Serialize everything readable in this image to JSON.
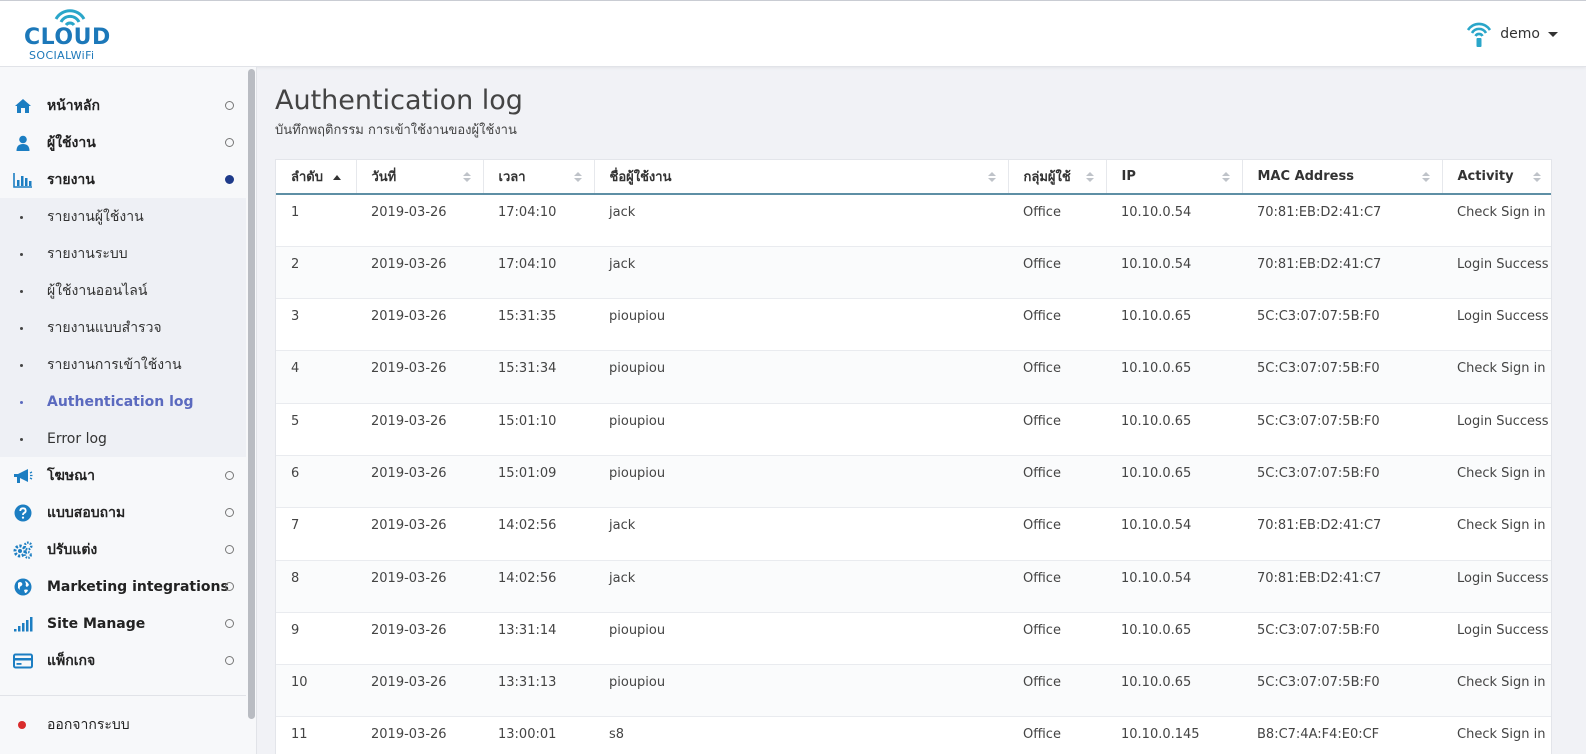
{
  "header": {
    "logo_main": "CLOUD",
    "logo_sub": "SOCIALWiFi",
    "user_name": "demo"
  },
  "sidebar": {
    "items": [
      {
        "label": "หน้าหลัก",
        "icon": "home-icon"
      },
      {
        "label": "ผู้ใช้งาน",
        "icon": "user-icon"
      },
      {
        "label": "รายงาน",
        "icon": "bar-chart-icon"
      },
      {
        "label": "โฆษณา",
        "icon": "megaphone-icon"
      },
      {
        "label": "แบบสอบถาม",
        "icon": "question-icon"
      },
      {
        "label": "ปรับแต่ง",
        "icon": "gears-icon"
      },
      {
        "label": "Marketing integrations",
        "icon": "globe-icon"
      },
      {
        "label": "Site Manage",
        "icon": "signal-icon"
      },
      {
        "label": "แพ็กเกจ",
        "icon": "credit-card-icon"
      }
    ],
    "report_submenu": [
      "รายงานผู้ใช้งาน",
      "รายงานระบบ",
      "ผู้ใช้งานออนไลน์",
      "รายงานแบบสำรวจ",
      "รายงานการเข้าใช้งาน",
      "Authentication log",
      "Error log"
    ],
    "logout": "ออกจากระบบ"
  },
  "page": {
    "title": "Authentication log",
    "subtitle": "บันทึกพฤติกรรม การเข้าใช้งานของผู้ใช้งาน"
  },
  "table": {
    "columns": [
      "ลำดับ",
      "วันที่",
      "เวลา",
      "ชื่อผู้ใช้งาน",
      "กลุ่มผู้ใช้",
      "IP",
      "MAC Address",
      "Activity"
    ],
    "rows": [
      [
        "1",
        "2019-03-26",
        "17:04:10",
        "jack",
        "Office",
        "10.10.0.54",
        "70:81:EB:D2:41:C7",
        "Check Sign in"
      ],
      [
        "2",
        "2019-03-26",
        "17:04:10",
        "jack",
        "Office",
        "10.10.0.54",
        "70:81:EB:D2:41:C7",
        "Login Success"
      ],
      [
        "3",
        "2019-03-26",
        "15:31:35",
        "pioupiou",
        "Office",
        "10.10.0.65",
        "5C:C3:07:07:5B:F0",
        "Login Success"
      ],
      [
        "4",
        "2019-03-26",
        "15:31:34",
        "pioupiou",
        "Office",
        "10.10.0.65",
        "5C:C3:07:07:5B:F0",
        "Check Sign in"
      ],
      [
        "5",
        "2019-03-26",
        "15:01:10",
        "pioupiou",
        "Office",
        "10.10.0.65",
        "5C:C3:07:07:5B:F0",
        "Login Success"
      ],
      [
        "6",
        "2019-03-26",
        "15:01:09",
        "pioupiou",
        "Office",
        "10.10.0.65",
        "5C:C3:07:07:5B:F0",
        "Check Sign in"
      ],
      [
        "7",
        "2019-03-26",
        "14:02:56",
        "jack",
        "Office",
        "10.10.0.54",
        "70:81:EB:D2:41:C7",
        "Check Sign in"
      ],
      [
        "8",
        "2019-03-26",
        "14:02:56",
        "jack",
        "Office",
        "10.10.0.54",
        "70:81:EB:D2:41:C7",
        "Login Success"
      ],
      [
        "9",
        "2019-03-26",
        "13:31:14",
        "pioupiou",
        "Office",
        "10.10.0.65",
        "5C:C3:07:07:5B:F0",
        "Login Success"
      ],
      [
        "10",
        "2019-03-26",
        "13:31:13",
        "pioupiou",
        "Office",
        "10.10.0.65",
        "5C:C3:07:07:5B:F0",
        "Check Sign in"
      ],
      [
        "11",
        "2019-03-26",
        "13:00:01",
        "s8",
        "Office",
        "10.10.0.145",
        "B8:C7:4A:F4:E0:CF",
        "Check Sign in"
      ]
    ]
  },
  "colors": {
    "brand": "#1c78b9",
    "active_dot": "#1e3a8a",
    "active_submenu": "#5b6abf",
    "logout_dot": "#d92c2c"
  }
}
